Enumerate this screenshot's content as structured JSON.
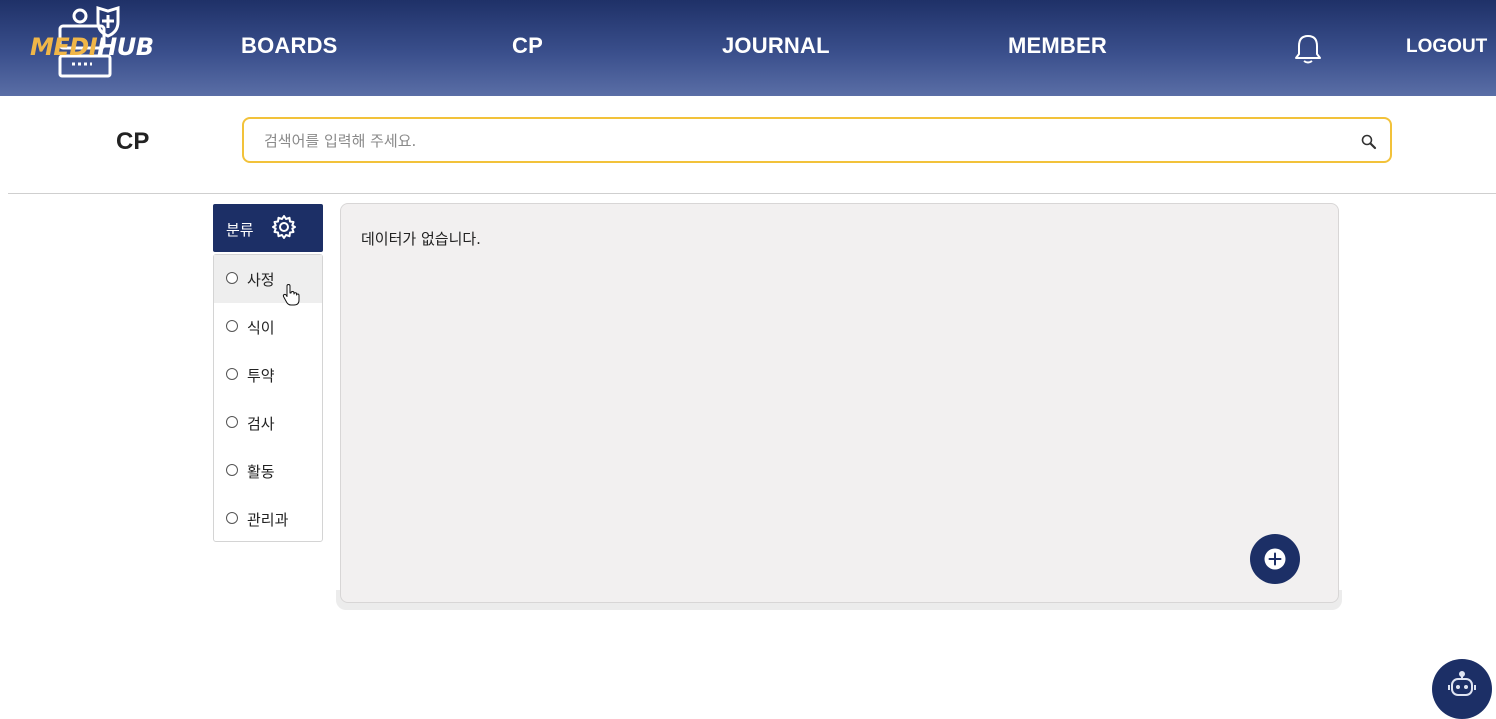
{
  "header": {
    "logo": {
      "part1": "MEDI",
      "part2": "HUB"
    },
    "nav": [
      "BOARDS",
      "CP",
      "JOURNAL",
      "MEMBER"
    ],
    "logout_label": "LOGOUT"
  },
  "page": {
    "title": "CP",
    "search_placeholder": "검색어를 입력해 주세요."
  },
  "sidebar": {
    "header_label": "분류",
    "items": [
      "사정",
      "식이",
      "투약",
      "검사",
      "활동",
      "관리과"
    ],
    "hovered_item": "사정"
  },
  "content": {
    "empty_message": "데이터가 없습니다."
  },
  "colors": {
    "nav_gradient_top": "#1f3168",
    "nav_gradient_bottom": "#5a6ea6",
    "primary": "#1c2f66",
    "search_border": "#f2c23a",
    "logo_accent": "#f0b648",
    "content_bg": "#f2f0f0"
  },
  "icons": [
    "logo-icon",
    "bell-icon",
    "search-icon",
    "gear-icon",
    "radio-icon",
    "hand-pointer-icon",
    "plus-icon",
    "robot-icon"
  ]
}
